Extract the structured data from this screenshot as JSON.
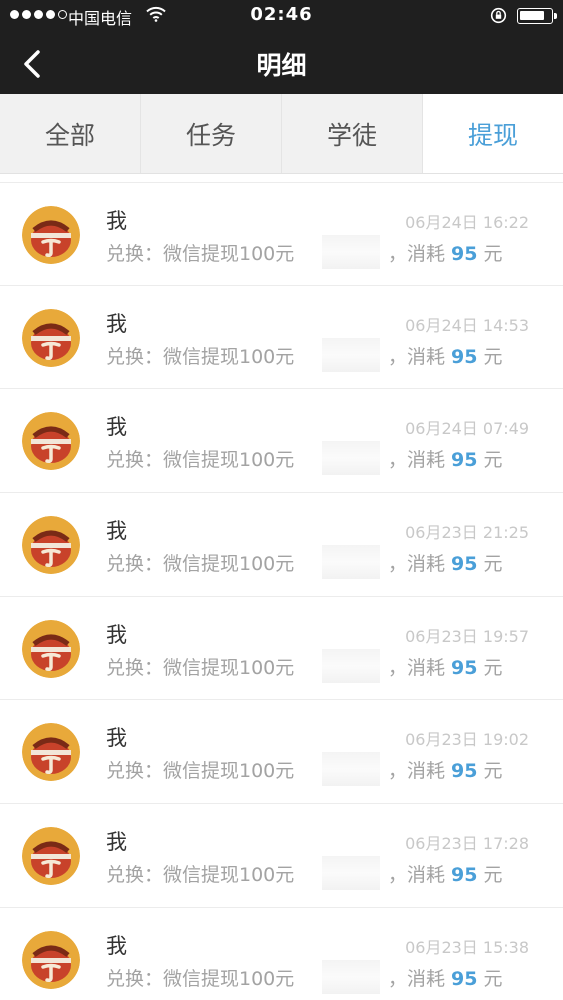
{
  "status_bar": {
    "carrier": "中国电信",
    "time": "02:46"
  },
  "nav": {
    "title": "明细"
  },
  "tabs": [
    {
      "label": "全部",
      "active": false
    },
    {
      "label": "任务",
      "active": false
    },
    {
      "label": "学徒",
      "active": false
    },
    {
      "label": "提现",
      "active": true
    }
  ],
  "colors": {
    "header_bg": "#1f1f1f",
    "accent": "#4a9fd8",
    "tab_bg": "#f1f1f1",
    "avatar_orange": "#e8a93a",
    "avatar_red": "#c8422a"
  },
  "records": [
    {
      "name": "我",
      "time": "06月24日 16:22",
      "desc": "兑换：微信提现100元",
      "cost_prefix": "，消耗",
      "amount": "95",
      "unit": "元"
    },
    {
      "name": "我",
      "time": "06月24日 14:53",
      "desc": "兑换：微信提现100元",
      "cost_prefix": "，消耗",
      "amount": "95",
      "unit": "元"
    },
    {
      "name": "我",
      "time": "06月24日 07:49",
      "desc": "兑换：微信提现100元",
      "cost_prefix": "，消耗",
      "amount": "95",
      "unit": "元"
    },
    {
      "name": "我",
      "time": "06月23日 21:25",
      "desc": "兑换：微信提现100元",
      "cost_prefix": "，消耗",
      "amount": "95",
      "unit": "元"
    },
    {
      "name": "我",
      "time": "06月23日 19:57",
      "desc": "兑换：微信提现100元",
      "cost_prefix": "，消耗",
      "amount": "95",
      "unit": "元"
    },
    {
      "name": "我",
      "time": "06月23日 19:02",
      "desc": "兑换：微信提现100元",
      "cost_prefix": "，消耗",
      "amount": "95",
      "unit": "元"
    },
    {
      "name": "我",
      "time": "06月23日 17:28",
      "desc": "兑换：微信提现100元",
      "cost_prefix": "，消耗",
      "amount": "95",
      "unit": "元"
    },
    {
      "name": "我",
      "time": "06月23日 15:38",
      "desc": "兑换：微信提现100元",
      "cost_prefix": "，消耗",
      "amount": "95",
      "unit": "元"
    }
  ]
}
